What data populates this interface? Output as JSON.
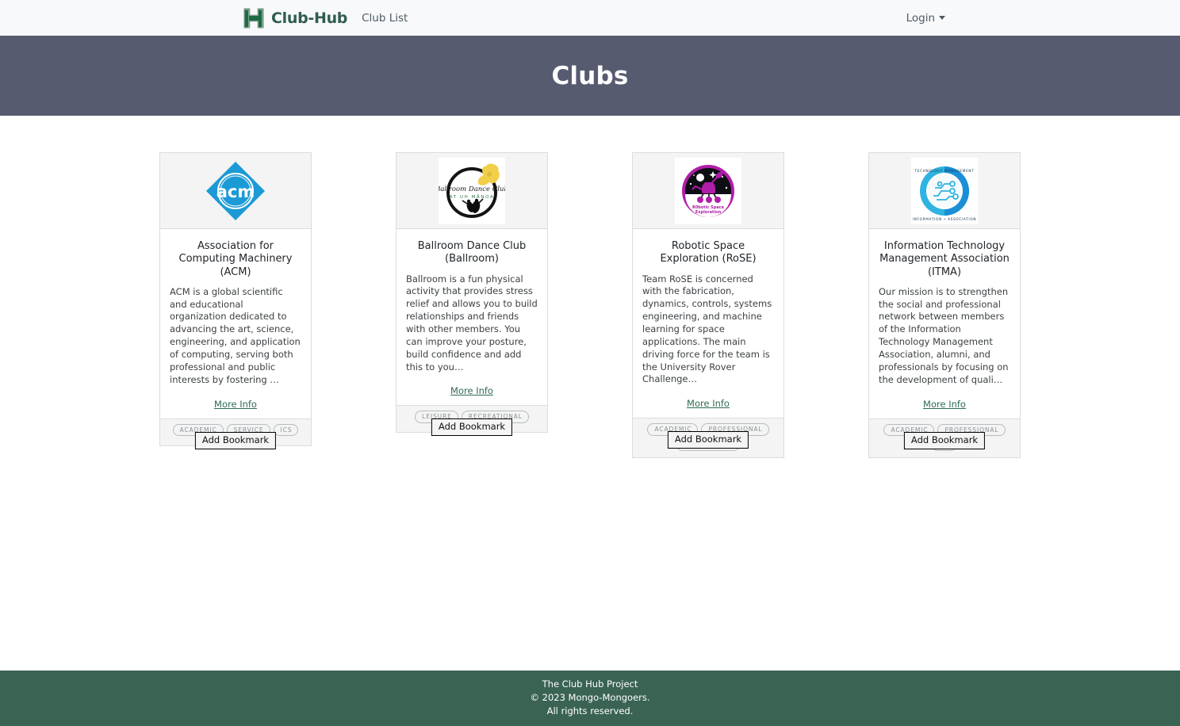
{
  "navbar": {
    "logo_icon": "uh-h-logo-icon",
    "brand": "Club-Hub",
    "club_list_label": "Club List",
    "login_label": "Login",
    "caret_icon": "chevron-down-icon",
    "background": "#f8f9fa",
    "brand_color": "#2f5d50"
  },
  "hero": {
    "title": "Clubs",
    "background": "#565b70",
    "text_color": "#ffffff"
  },
  "cards": [
    {
      "logo_icon": "acm-logo-icon",
      "title": "Association for Computing Machinery (ACM)",
      "description": "ACM is a global scientific and educational organization dedicated to advancing the art, science, engineering, and application of computing, serving both professional and public interests by fostering …",
      "more_info_label": "More Info",
      "badges": [
        "ACADEMIC",
        "SERVICE",
        "ICS"
      ],
      "bookmark_label": "Add Bookmark"
    },
    {
      "logo_icon": "ballroom-dance-club-logo-icon",
      "title": "Ballroom Dance Club (Ballroom)",
      "description": "Ballroom is a fun physical activity that provides stress relief and allows you to build relationships and friends with other members. You can improve your posture, build confidence and add this to you…",
      "more_info_label": "More Info",
      "badges": [
        "LEISURE",
        "RECREATIONAL"
      ],
      "bookmark_label": "Add Bookmark"
    },
    {
      "logo_icon": "robotic-space-exploration-logo-icon",
      "title": "Robotic Space Exploration (RoSE)",
      "description": "Team RoSE is concerned with the fabrication, dynamics, controls, systems engineering, and machine learning for space applications. The main driving force for the team is the University Rover Challenge…",
      "more_info_label": "More Info",
      "badges": [
        "ACADEMIC",
        "PROFESSIONAL",
        "ENGINEERING"
      ],
      "bookmark_label": "Add Bookmark"
    },
    {
      "logo_icon": "itma-logo-icon",
      "title": "Information Technology Management Association (ITMA)",
      "description": "Our mission is to strengthen the social and professional network between members of the Information Technology Management Association, alumni, and professionals by focusing on the development of quali…",
      "more_info_label": "More Info",
      "badges": [
        "ACADEMIC",
        "PROFESSIONAL",
        "ICS"
      ],
      "bookmark_label": "Add Bookmark"
    }
  ],
  "footer": {
    "line1": "The Club Hub Project",
    "line2": "© 2023 Mongo-Mongoers.",
    "line3": "All rights reserved.",
    "background": "#3a6354"
  }
}
